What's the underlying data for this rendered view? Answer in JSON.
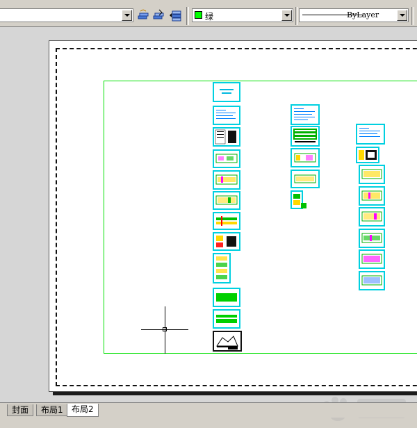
{
  "toolbar": {
    "color_combo": {
      "value": "绿",
      "swatch": "#00ff00"
    },
    "linetype_combo": {
      "value": "ByLayer"
    }
  },
  "tabs": [
    {
      "label": "封面"
    },
    {
      "label": "布局1"
    },
    {
      "label": "布局2",
      "active": true
    }
  ],
  "colors": {
    "viewport_border": "#00e000",
    "sheet_border": "#00d0e0",
    "paper": "#ffffff",
    "canvas_bg": "#d6d6d6"
  },
  "icons": [
    "layer-states-icon",
    "make-layer-current-icon",
    "layer-previous-icon",
    "dropdown-arrow-icon",
    "crosshair-cursor-icon",
    "baidu-watermark-icon"
  ]
}
